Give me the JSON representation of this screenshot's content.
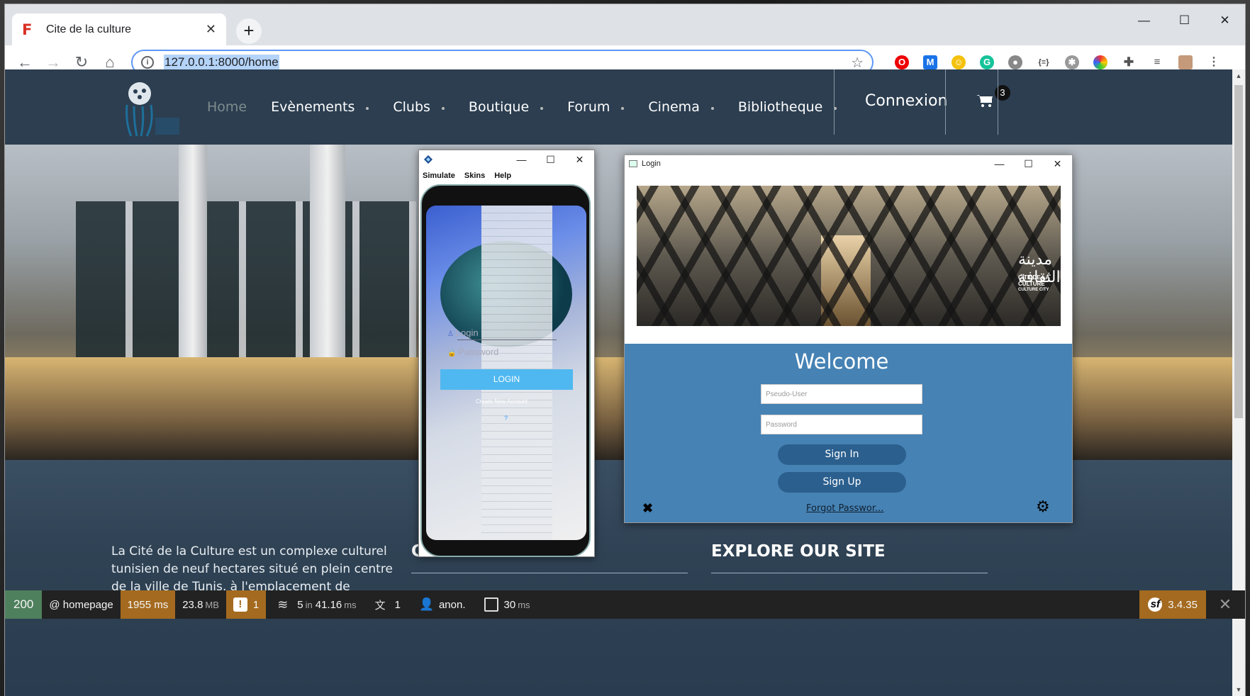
{
  "browser": {
    "tab_title": "Cite de la culture",
    "url": "127.0.0.1:8000/home",
    "window_controls": [
      "minimize-icon",
      "maximize-icon",
      "close-icon"
    ]
  },
  "site": {
    "nav": [
      {
        "label": "Home",
        "active": true
      },
      {
        "label": "Evènements"
      },
      {
        "label": "Clubs"
      },
      {
        "label": "Boutique"
      },
      {
        "label": "Forum"
      },
      {
        "label": "Cinema"
      },
      {
        "label": "Bibliotheque"
      }
    ],
    "connexion": "Connexion",
    "cart_count": "3",
    "about_text": "La Cité de la Culture est un complexe culturel tunisien de neuf hectares situé en plein centre de la ville de Tunis, à l'emplacement de l'ancienne",
    "contact_heading": "Contact us",
    "explore_heading": "EXPLORE OUR SITE"
  },
  "simulator": {
    "menu": [
      "Simulate",
      "Skins",
      "Help"
    ],
    "login_placeholder": "Login",
    "password_placeholder": "Password",
    "login_button": "LOGIN",
    "create_account": "Create New Account",
    "question": "?"
  },
  "login_window": {
    "title": "Login",
    "banner_arabic": "مدينة الثقافة",
    "banner_logo_line1": "CITE DE LA",
    "banner_logo_line2": "CULTURE",
    "banner_logo_line3": "CULTURE CITY",
    "welcome": "Welcome",
    "user_placeholder": "Pseudo-User",
    "password_placeholder": "Password",
    "sign_in": "Sign In",
    "sign_up": "Sign Up",
    "forgot": "Forgot Passwor..."
  },
  "symfony_toolbar": {
    "status": "200",
    "route": "@ homepage",
    "time": "1955 ms",
    "memory": "23.8",
    "memory_unit": "MB",
    "warnings": "1",
    "cache_count": "5",
    "cache_in": "in",
    "cache_time": "41.16",
    "cache_unit": "ms",
    "translations": "1",
    "user": "anon.",
    "twig_time": "30",
    "twig_unit": "ms",
    "version": "3.4.35"
  }
}
